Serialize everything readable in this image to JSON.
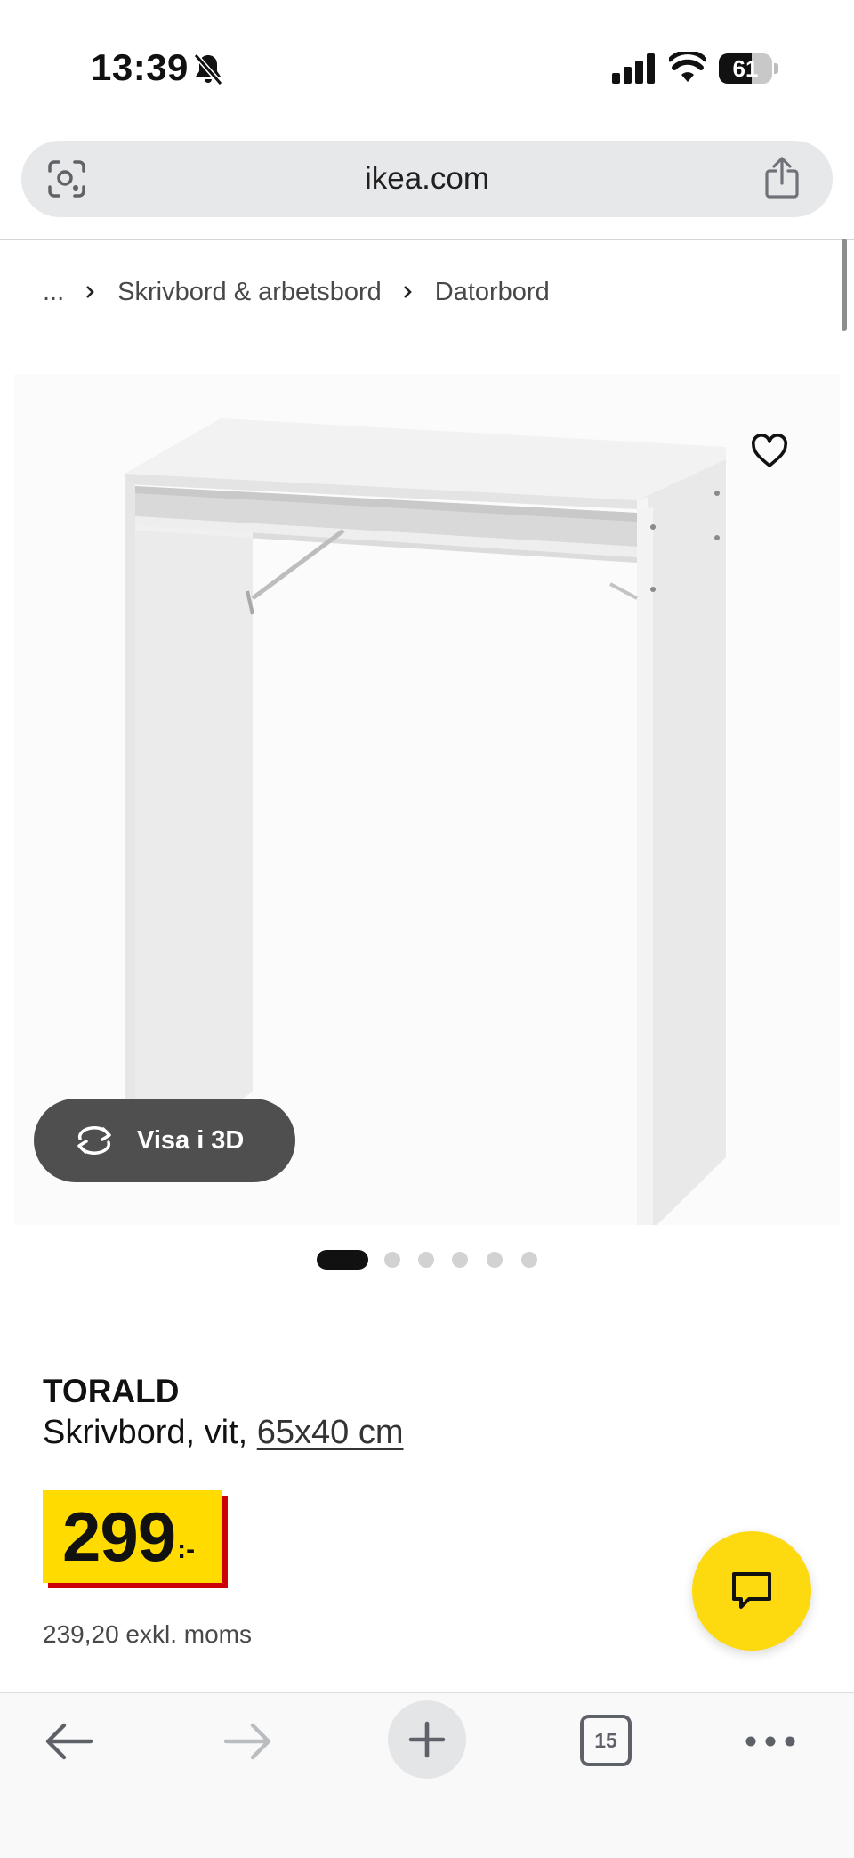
{
  "status_bar": {
    "time": "13:39",
    "battery_percent": "61",
    "battery_level": 0.61,
    "icons": [
      "bell-off-icon",
      "cellular-signal-icon",
      "wifi-icon",
      "battery-icon"
    ]
  },
  "browser": {
    "url": "ikea.com",
    "tab_count": "15",
    "icons": [
      "lens-icon",
      "share-icon",
      "back-arrow-icon",
      "forward-arrow-icon",
      "plus-icon",
      "tabs-icon",
      "more-icon"
    ]
  },
  "breadcrumb": {
    "items": [
      "...",
      "Skrivbord & arbetsbord",
      "Datorbord"
    ]
  },
  "product_image": {
    "view_3d_label": "Visa i 3D",
    "carousel": {
      "total": 6,
      "active_index": 1
    },
    "icons": [
      "heart-icon",
      "rotate-3d-icon"
    ]
  },
  "product": {
    "name": "TORALD",
    "description": "Skrivbord, vit, ",
    "size_link": "65x40 cm",
    "price": "299",
    "price_suffix": ":-",
    "price_excl_vat": "239,20 exkl. moms"
  },
  "colors": {
    "price_yellow": "#ffdb00",
    "price_red": "#cc0008",
    "chat_yellow": "#fdd90f",
    "dark_button": "#4f4f4f"
  },
  "chat": {
    "icon": "chat-bubble-icon"
  }
}
